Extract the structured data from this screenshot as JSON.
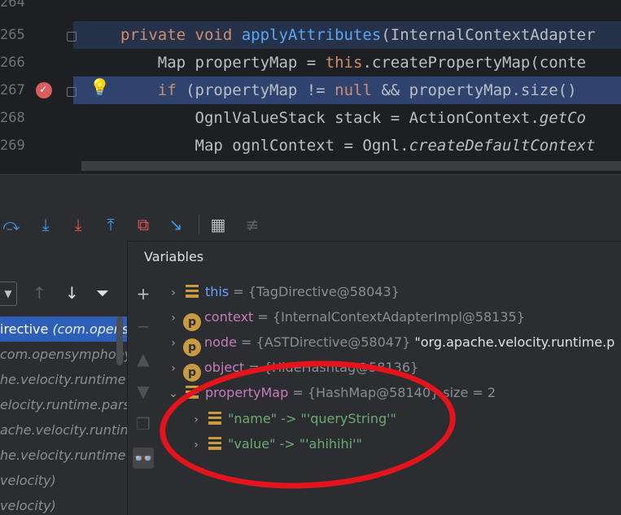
{
  "editor": {
    "lines": [
      {
        "num": "264",
        "code": ""
      },
      {
        "num": "265",
        "parts": [
          [
            "kw",
            "private "
          ],
          [
            "kw",
            "void "
          ],
          [
            "fn",
            "applyAttributes"
          ],
          [
            "",
            "(InternalContextAdapter"
          ]
        ]
      },
      {
        "num": "266",
        "parts": [
          [
            "",
            "    Map propertyMap = "
          ],
          [
            "kw",
            "this"
          ],
          [
            "",
            ".createPropertyMap(conte"
          ]
        ]
      },
      {
        "num": "267",
        "parts": [
          [
            "",
            "    "
          ],
          [
            "kw",
            "if "
          ],
          [
            "",
            "(propertyMap != "
          ],
          [
            "kw",
            "null"
          ],
          [
            "",
            " && propertyMap.size() "
          ]
        ]
      },
      {
        "num": "268",
        "parts": [
          [
            "",
            "        OgnlValueStack stack = ActionContext."
          ],
          [
            "it",
            "getCo"
          ]
        ]
      },
      {
        "num": "269",
        "parts": [
          [
            "",
            "        Map ognlContext = Ognl."
          ],
          [
            "it",
            "createDefaultContext"
          ]
        ]
      }
    ]
  },
  "toolbar": {
    "icons": [
      "step-over-icon",
      "step-into-icon",
      "force-step-into-icon",
      "step-out-icon",
      "drop-frame-icon",
      "run-to-cursor-icon",
      "evaluate-expression-icon",
      "trace-current-stream-icon"
    ]
  },
  "frames": {
    "items": [
      {
        "main": "irective ",
        "pkg": "(com.opens",
        "selected": true
      },
      {
        "main": "com.opensymphony",
        "pkg": "",
        "selected": false
      },
      {
        "main": "he.velocity.runtime",
        "pkg": "",
        "selected": false
      },
      {
        "main": "elocity.runtime.pars",
        "pkg": "",
        "selected": false
      },
      {
        "main": "ache.velocity.runtin",
        "pkg": "",
        "selected": false
      },
      {
        "main": "he.velocity.runtime",
        "pkg": "",
        "selected": false
      },
      {
        "main": "velocity)",
        "pkg": "",
        "selected": false
      },
      {
        "main": "velocity)",
        "pkg": "",
        "selected": false
      }
    ]
  },
  "variables": {
    "title": "Variables",
    "rows": [
      {
        "kind": "f",
        "name": "this",
        "value": " = {TagDirective@58043}",
        "extra": "",
        "expanded": false,
        "indent": 0
      },
      {
        "kind": "p",
        "name": "context",
        "value": " = {InternalContextAdapterImpl@58135}",
        "extra": "",
        "expanded": false,
        "indent": 0
      },
      {
        "kind": "p",
        "name": "node",
        "value": " = {ASTDirective@58047} ",
        "extra": "\"org.apache.velocity.runtime.p",
        "expanded": false,
        "indent": 0
      },
      {
        "kind": "p",
        "name": "object",
        "value": " = {HideHashtag@58136}",
        "extra": "",
        "expanded": false,
        "indent": 0
      },
      {
        "kind": "f",
        "name": "propertyMap",
        "value": " = {HashMap@58140}  size = 2",
        "extra": "",
        "expanded": true,
        "indent": 0
      },
      {
        "kind": "f",
        "name": "\"name\" -> \"'queryString'\"",
        "value": "",
        "extra": "",
        "expanded": false,
        "indent": 1,
        "str": true
      },
      {
        "kind": "f",
        "name": "\"value\" -> \"'ahihihi'\"",
        "value": "",
        "extra": "",
        "expanded": false,
        "indent": 1,
        "str": true
      }
    ]
  },
  "colors": {
    "accent": "#2e5fb8",
    "annotation": "#e3141b"
  }
}
